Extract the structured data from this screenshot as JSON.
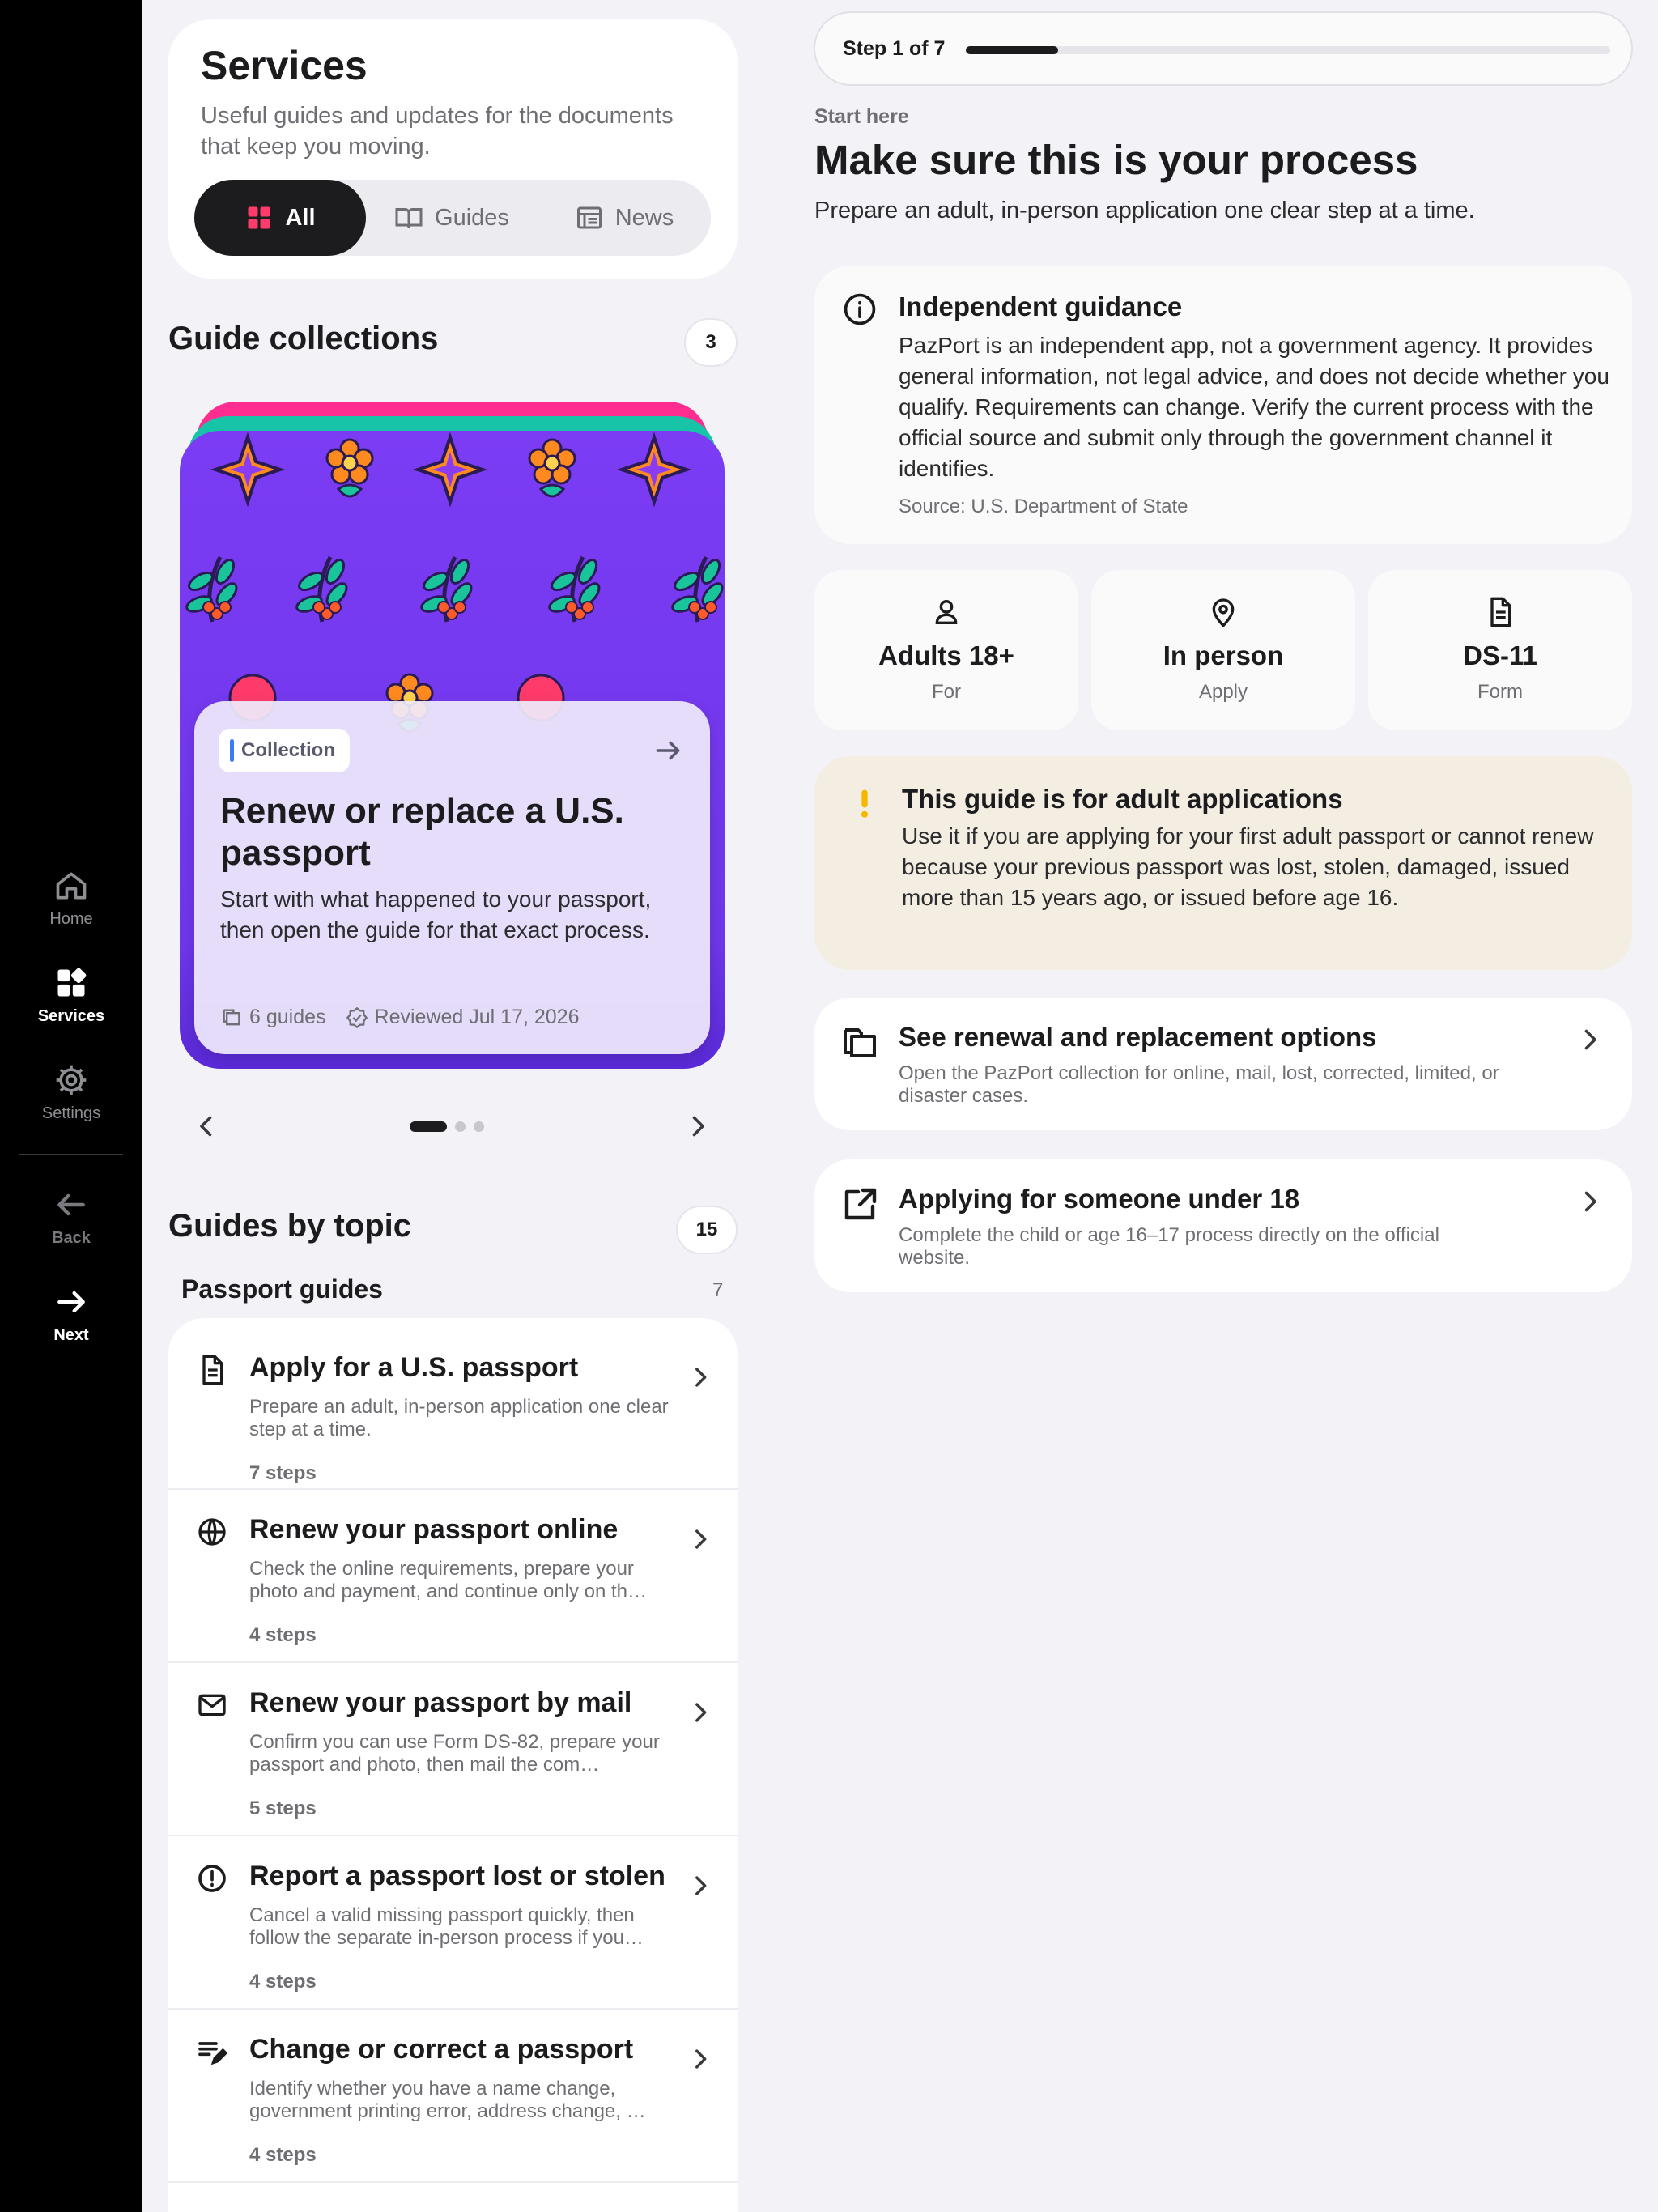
{
  "rail": {
    "items": [
      {
        "label": "Home",
        "icon": "home-icon"
      },
      {
        "label": "Services",
        "icon": "grid-icon"
      },
      {
        "label": "Settings",
        "icon": "gear-icon"
      },
      {
        "label": "Back",
        "icon": "arrow-left-icon"
      },
      {
        "label": "Next",
        "icon": "arrow-right-icon"
      }
    ]
  },
  "services": {
    "title": "Services",
    "subtitle": "Useful guides and updates for the documents that keep you moving.",
    "segments": [
      "All",
      "Guides",
      "News"
    ],
    "selected_segment": "All"
  },
  "collections": {
    "title": "Guide collections",
    "count": "3",
    "card": {
      "tag": "Collection",
      "title": "Renew or replace a U.S. passport",
      "desc": "Start with what happened to your passport, then open the guide for that exact process.",
      "guides": "6 guides",
      "reviewed": "Reviewed Jul 17, 2026"
    },
    "page_index": 1,
    "page_total": 3
  },
  "topics": {
    "title": "Guides by topic",
    "count": "15",
    "section": "Passport guides",
    "section_count": "7",
    "guides": [
      {
        "title": "Apply for a U.S. passport",
        "desc": "Prepare an adult, in-person application one clear step at a time.",
        "steps": "7 steps",
        "icon": "document-icon"
      },
      {
        "title": "Renew your passport online",
        "desc": "Check the online requirements, prepare your photo and payment, and continue only on th…",
        "steps": "4 steps",
        "icon": "globe-icon"
      },
      {
        "title": "Renew your passport by mail",
        "desc": "Confirm you can use Form DS-82, prepare your passport and photo, then mail the com…",
        "steps": "5 steps",
        "icon": "envelope-icon"
      },
      {
        "title": "Report a passport lost or stolen",
        "desc": "Cancel a valid missing passport quickly, then follow the separate in-person process if you…",
        "steps": "4 steps",
        "icon": "alert-circle-icon"
      },
      {
        "title": "Change or correct a passport",
        "desc": "Identify whether you have a name change, government printing error, address change, …",
        "steps": "4 steps",
        "icon": "edit-list-icon"
      }
    ]
  },
  "detail": {
    "step_label": "Step 1 of 7",
    "progress": 0.143,
    "eyebrow": "Start here",
    "title": "Make sure this is your process",
    "subtitle": "Prepare an adult, in-person application one clear step at a time.",
    "notice": {
      "title": "Independent guidance",
      "body": "PazPort is an independent app, not a government agency. It provides general information, not legal advice, and does not decide whether you qualify. Requirements can change. Verify the current process with the official source and submit only through the government channel it identifies.",
      "source": "Source: U.S. Department of State"
    },
    "facts": [
      {
        "value": "Adults 18+",
        "label": "For",
        "icon": "person-icon"
      },
      {
        "value": "In person",
        "label": "Apply",
        "icon": "location-pin-icon"
      },
      {
        "value": "DS-11",
        "label": "Form",
        "icon": "document-icon"
      }
    ],
    "warning": {
      "title": "This guide is for adult applications",
      "body": "Use it if you are applying for your first adult passport or cannot renew because your previous passport was lost, stolen, damaged, issued more than 15 years ago, or issued before age 16."
    },
    "links": [
      {
        "title": "See renewal and replacement options",
        "desc": "Open the PazPort collection for online, mail, lost, corrected, limited, or disaster cases.",
        "icon": "folders-icon"
      },
      {
        "title": "Applying for someone under 18",
        "desc": "Complete the child or age 16–17 process directly on the official website.",
        "icon": "external-link-icon"
      }
    ]
  },
  "colors": {
    "accent": "#1c1c1e",
    "card_purple": "#7d3cf2",
    "warning_bg": "#f3ede2",
    "warning_icon": "#f5b800",
    "collection_tag": "#3d7bf5"
  }
}
